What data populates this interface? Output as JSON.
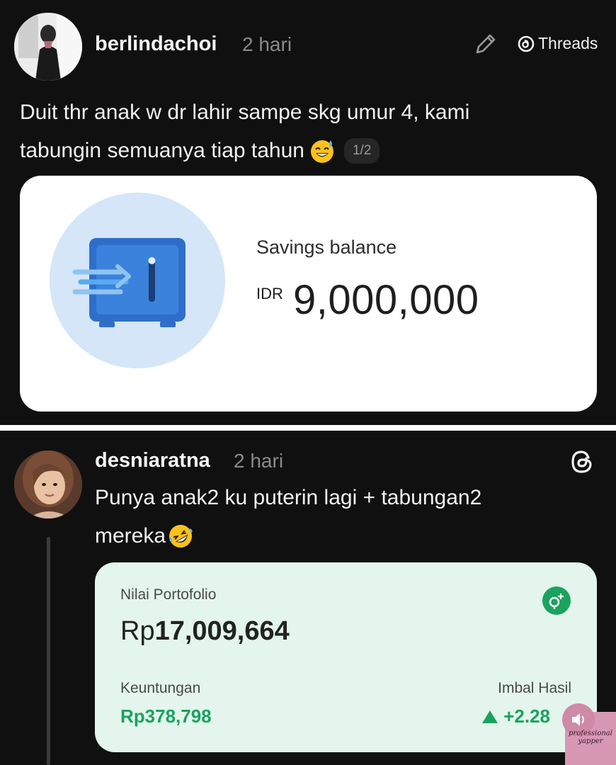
{
  "post1": {
    "username": "berlindachoi",
    "time": "2 hari",
    "threads_label": "Threads",
    "text_line1": "Duit thr anak w dr lahir sampe skg umur 4, kami",
    "text_line2": "tabungin semuanya tiap tahun",
    "emoji": "sweat-smile-emoji",
    "page_indicator": "1/2",
    "card": {
      "label": "Savings balance",
      "currency": "IDR",
      "amount": "9,000,000",
      "icon": "safe-icon",
      "accent": "#2f6ec8"
    }
  },
  "post2": {
    "username": "desniaratna",
    "time": "2 hari",
    "text_line1": "Punya anak2 ku puterin lagi + tabungan2",
    "text_line2": "mereka",
    "emoji": "rofl-emoji",
    "card": {
      "portfolio_label": "Nilai Portofolio",
      "portfolio_currency": "Rp",
      "portfolio_value": "17,009,664",
      "profit_label": "Keuntungan",
      "profit_value": "Rp378,798",
      "return_label": "Imbal Hasil",
      "return_value": "+2.28",
      "accent": "#1aa35e"
    }
  },
  "watermark": {
    "line1": "professional",
    "line2": "yapper"
  }
}
